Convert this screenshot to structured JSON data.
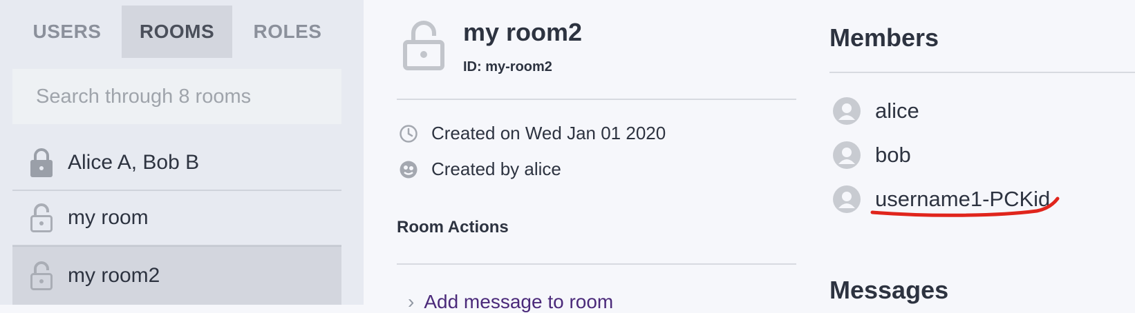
{
  "sidebar": {
    "tabs": [
      {
        "label": "USERS",
        "active": false
      },
      {
        "label": "ROOMS",
        "active": true
      },
      {
        "label": "ROLES",
        "active": false
      }
    ],
    "search": {
      "placeholder": "Search through 8 rooms"
    },
    "rooms": [
      {
        "label": "Alice A, Bob B",
        "icon": "lock-closed-icon"
      },
      {
        "label": "my room",
        "icon": "lock-open-icon"
      },
      {
        "label": "my room2",
        "icon": "lock-open-icon",
        "active": true
      }
    ]
  },
  "room": {
    "title": "my room2",
    "id_text": "ID: my-room2",
    "created_on": "Created on Wed Jan 01 2020",
    "created_by": "Created by alice",
    "actions_heading": "Room Actions",
    "actions": [
      {
        "label": "Add message to room"
      }
    ]
  },
  "members": {
    "heading": "Members",
    "items": [
      {
        "name": "alice"
      },
      {
        "name": "bob"
      },
      {
        "name": "username1-PCKid",
        "highlighted": true
      }
    ]
  },
  "messages": {
    "heading": "Messages"
  },
  "colors": {
    "sidebar_bg": "#e7eaf1",
    "active_bg": "#d3d6de",
    "main_bg": "#f6f7fb",
    "text": "#2d3340",
    "link": "#4b2a7a",
    "annotation_red": "#e0251c"
  }
}
